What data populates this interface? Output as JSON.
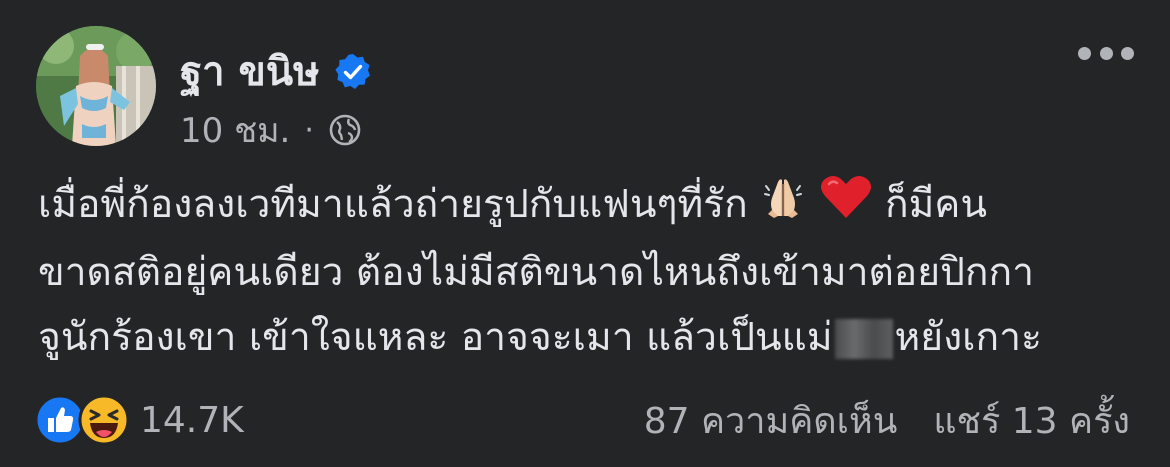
{
  "post": {
    "author": {
      "name": "ฐา ขนิษ",
      "verified": true
    },
    "meta": {
      "time": "10 ชม.",
      "separator": "·",
      "audience_icon": "globe-icon"
    },
    "more_icon": "more-options-icon",
    "text_lines": [
      {
        "before": "เมื่อพี่ก้องลงเวทีมาแล้วถ่ายรูปกับแฟนๆที่รัก ",
        "emojis": [
          "folded-hands-emoji",
          "red-heart-emoji"
        ],
        "after": " ก็มีคน"
      },
      {
        "text": "ขาดสติอยู่คนเดียว ต้องไม่มีสติขนาดไหนถึงเข้ามาต่อยปิกกา"
      },
      {
        "before": "จูนักร้องเขา เข้าใจแหละ อาจจะเมา แล้วเป็นแม่",
        "censored": true,
        "after": "หยังเกาะ"
      }
    ],
    "reactions": {
      "icons": [
        "like-icon",
        "haha-icon"
      ],
      "count": "14.7K"
    },
    "comments": "87 ความคิดเห็น",
    "shares": "แชร์ 13 ครั้ง"
  },
  "colors": {
    "background": "#242526",
    "primary_text": "#e4e6eb",
    "secondary_text": "#b0b3b8",
    "verified_blue": "#1877f2",
    "like_blue": "#1877f2",
    "haha_yellow": "#f7b928"
  }
}
